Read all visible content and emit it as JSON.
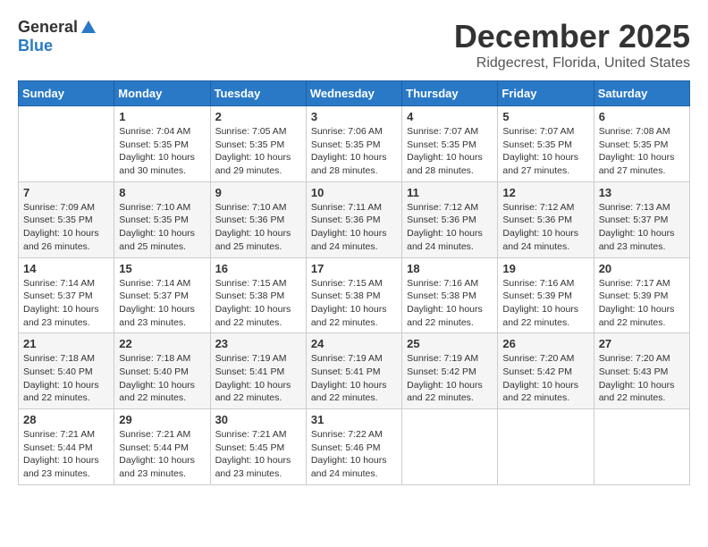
{
  "header": {
    "logo_general": "General",
    "logo_blue": "Blue",
    "month_title": "December 2025",
    "location": "Ridgecrest, Florida, United States"
  },
  "weekdays": [
    "Sunday",
    "Monday",
    "Tuesday",
    "Wednesday",
    "Thursday",
    "Friday",
    "Saturday"
  ],
  "weeks": [
    [
      {
        "day": "",
        "info": ""
      },
      {
        "day": "1",
        "info": "Sunrise: 7:04 AM\nSunset: 5:35 PM\nDaylight: 10 hours\nand 30 minutes."
      },
      {
        "day": "2",
        "info": "Sunrise: 7:05 AM\nSunset: 5:35 PM\nDaylight: 10 hours\nand 29 minutes."
      },
      {
        "day": "3",
        "info": "Sunrise: 7:06 AM\nSunset: 5:35 PM\nDaylight: 10 hours\nand 28 minutes."
      },
      {
        "day": "4",
        "info": "Sunrise: 7:07 AM\nSunset: 5:35 PM\nDaylight: 10 hours\nand 28 minutes."
      },
      {
        "day": "5",
        "info": "Sunrise: 7:07 AM\nSunset: 5:35 PM\nDaylight: 10 hours\nand 27 minutes."
      },
      {
        "day": "6",
        "info": "Sunrise: 7:08 AM\nSunset: 5:35 PM\nDaylight: 10 hours\nand 27 minutes."
      }
    ],
    [
      {
        "day": "7",
        "info": "Sunrise: 7:09 AM\nSunset: 5:35 PM\nDaylight: 10 hours\nand 26 minutes."
      },
      {
        "day": "8",
        "info": "Sunrise: 7:10 AM\nSunset: 5:35 PM\nDaylight: 10 hours\nand 25 minutes."
      },
      {
        "day": "9",
        "info": "Sunrise: 7:10 AM\nSunset: 5:36 PM\nDaylight: 10 hours\nand 25 minutes."
      },
      {
        "day": "10",
        "info": "Sunrise: 7:11 AM\nSunset: 5:36 PM\nDaylight: 10 hours\nand 24 minutes."
      },
      {
        "day": "11",
        "info": "Sunrise: 7:12 AM\nSunset: 5:36 PM\nDaylight: 10 hours\nand 24 minutes."
      },
      {
        "day": "12",
        "info": "Sunrise: 7:12 AM\nSunset: 5:36 PM\nDaylight: 10 hours\nand 24 minutes."
      },
      {
        "day": "13",
        "info": "Sunrise: 7:13 AM\nSunset: 5:37 PM\nDaylight: 10 hours\nand 23 minutes."
      }
    ],
    [
      {
        "day": "14",
        "info": "Sunrise: 7:14 AM\nSunset: 5:37 PM\nDaylight: 10 hours\nand 23 minutes."
      },
      {
        "day": "15",
        "info": "Sunrise: 7:14 AM\nSunset: 5:37 PM\nDaylight: 10 hours\nand 23 minutes."
      },
      {
        "day": "16",
        "info": "Sunrise: 7:15 AM\nSunset: 5:38 PM\nDaylight: 10 hours\nand 22 minutes."
      },
      {
        "day": "17",
        "info": "Sunrise: 7:15 AM\nSunset: 5:38 PM\nDaylight: 10 hours\nand 22 minutes."
      },
      {
        "day": "18",
        "info": "Sunrise: 7:16 AM\nSunset: 5:38 PM\nDaylight: 10 hours\nand 22 minutes."
      },
      {
        "day": "19",
        "info": "Sunrise: 7:16 AM\nSunset: 5:39 PM\nDaylight: 10 hours\nand 22 minutes."
      },
      {
        "day": "20",
        "info": "Sunrise: 7:17 AM\nSunset: 5:39 PM\nDaylight: 10 hours\nand 22 minutes."
      }
    ],
    [
      {
        "day": "21",
        "info": "Sunrise: 7:18 AM\nSunset: 5:40 PM\nDaylight: 10 hours\nand 22 minutes."
      },
      {
        "day": "22",
        "info": "Sunrise: 7:18 AM\nSunset: 5:40 PM\nDaylight: 10 hours\nand 22 minutes."
      },
      {
        "day": "23",
        "info": "Sunrise: 7:19 AM\nSunset: 5:41 PM\nDaylight: 10 hours\nand 22 minutes."
      },
      {
        "day": "24",
        "info": "Sunrise: 7:19 AM\nSunset: 5:41 PM\nDaylight: 10 hours\nand 22 minutes."
      },
      {
        "day": "25",
        "info": "Sunrise: 7:19 AM\nSunset: 5:42 PM\nDaylight: 10 hours\nand 22 minutes."
      },
      {
        "day": "26",
        "info": "Sunrise: 7:20 AM\nSunset: 5:42 PM\nDaylight: 10 hours\nand 22 minutes."
      },
      {
        "day": "27",
        "info": "Sunrise: 7:20 AM\nSunset: 5:43 PM\nDaylight: 10 hours\nand 22 minutes."
      }
    ],
    [
      {
        "day": "28",
        "info": "Sunrise: 7:21 AM\nSunset: 5:44 PM\nDaylight: 10 hours\nand 23 minutes."
      },
      {
        "day": "29",
        "info": "Sunrise: 7:21 AM\nSunset: 5:44 PM\nDaylight: 10 hours\nand 23 minutes."
      },
      {
        "day": "30",
        "info": "Sunrise: 7:21 AM\nSunset: 5:45 PM\nDaylight: 10 hours\nand 23 minutes."
      },
      {
        "day": "31",
        "info": "Sunrise: 7:22 AM\nSunset: 5:46 PM\nDaylight: 10 hours\nand 24 minutes."
      },
      {
        "day": "",
        "info": ""
      },
      {
        "day": "",
        "info": ""
      },
      {
        "day": "",
        "info": ""
      }
    ]
  ]
}
